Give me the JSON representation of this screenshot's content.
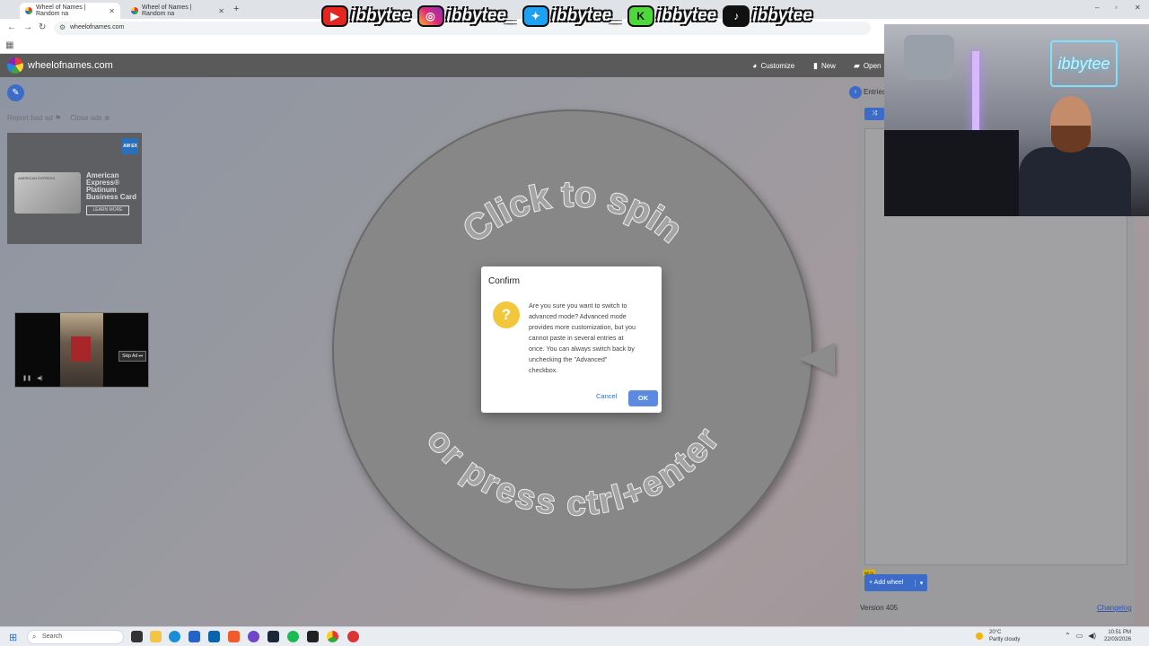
{
  "browser": {
    "tabs": [
      {
        "label": "Wheel of Names | Random na",
        "active": true
      },
      {
        "label": "Wheel of Names | Random na",
        "active": false
      }
    ],
    "new_tab": "+",
    "url": "wheelofnames.com",
    "window_controls": [
      "–",
      "▫",
      "✕"
    ]
  },
  "site": {
    "name": "wheelofnames.com",
    "nav": {
      "customize": "Customize",
      "new": "New",
      "open": "Open"
    }
  },
  "ads": {
    "report": "Report bad ad",
    "close": "Close ads",
    "amex": {
      "logo": "AM EX",
      "card_text": "AMERICAN EXPRESS",
      "title": "American Express® Platinum Business Card",
      "cta": "LEARN MORE"
    },
    "video": {
      "skip": "Skip Ad ⏭"
    }
  },
  "wheel": {
    "top_text": "Click to spin",
    "bottom_text": "or press ctrl+enter"
  },
  "panel": {
    "tab": "Entries",
    "beta": "BETA",
    "add_wheel": "Add wheel",
    "version": "Version 405",
    "changelog": "Changelog"
  },
  "dialog": {
    "title": "Confirm",
    "icon": "?",
    "message_lines": [
      "Are you sure you want to switch to",
      "advanced mode? Advanced mode",
      "provides more customization, but you",
      "cannot paste in several entries at",
      "once. You can always switch back by",
      "unchecking the \"Advanced\"",
      "checkbox."
    ],
    "cancel": "Cancel",
    "ok": "OK"
  },
  "overlay": {
    "social": [
      {
        "icon": "youtube-icon",
        "glyph": "▶",
        "handle": "ibbytee"
      },
      {
        "icon": "instagram-icon",
        "glyph": "◎",
        "handle": "ibbytee_"
      },
      {
        "icon": "twitter-icon",
        "glyph": "✦",
        "handle": "ibbytee_"
      },
      {
        "icon": "kick-icon",
        "glyph": "K",
        "handle": "ibbytee"
      },
      {
        "icon": "tiktok-icon",
        "glyph": "♪",
        "handle": "ibbytee"
      }
    ],
    "neon_sign": "ibbytee"
  },
  "taskbar": {
    "search": "Search",
    "weather_temp": "20°C",
    "weather_desc": "Partly cloudy",
    "time": "10:51 PM",
    "date": "22/03/2026"
  },
  "colors": {
    "accent": "#3d6cc8",
    "dialog_icon": "#f3c73c",
    "overlay_dim": "#8e95a2"
  }
}
